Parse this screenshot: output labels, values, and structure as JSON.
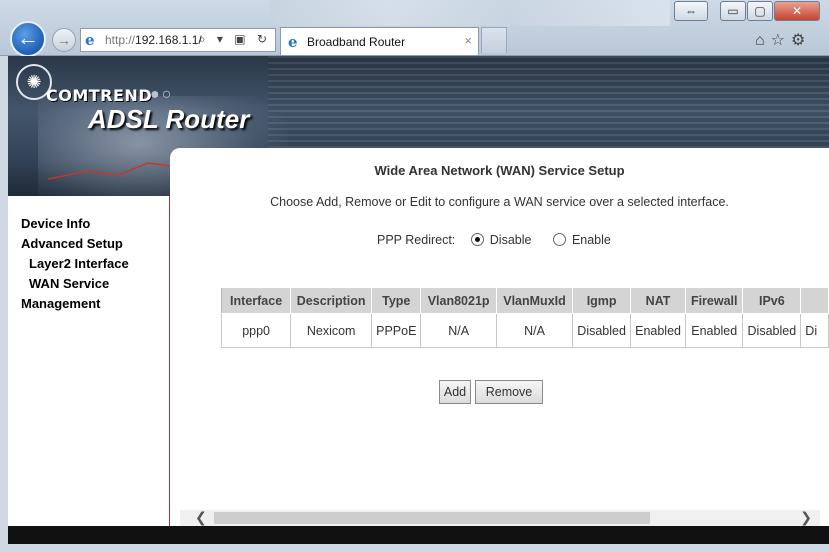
{
  "browser": {
    "url_host": "http://",
    "url_path": "192.168.1.1/",
    "address_tools": "⌕ ▾ ▣ ↻",
    "tab_title": "Broadband Router",
    "tab_close": "×",
    "back_glyph": "←",
    "forward_glyph": "→",
    "right_icons": "⌂☆⚙",
    "window_buttons": {
      "restore": "⇔",
      "minimize": "▭",
      "maximize": "▢",
      "close": "✕"
    }
  },
  "banner": {
    "brand": "COMTREND",
    "dots": "●○",
    "product": "ADSL Router"
  },
  "sidebar": {
    "items": [
      {
        "label": "Device Info",
        "sub": false
      },
      {
        "label": "Advanced Setup",
        "sub": false
      },
      {
        "label": "Layer2 Interface",
        "sub": true
      },
      {
        "label": "WAN Service",
        "sub": true
      },
      {
        "label": "Management",
        "sub": false
      }
    ]
  },
  "main": {
    "heading": "Wide Area Network (WAN) Service Setup",
    "hint": "Choose Add, Remove or Edit to configure a WAN service over a selected interface.",
    "ppp_redirect": {
      "label": "PPP Redirect:",
      "options": [
        "Disable",
        "Enable"
      ],
      "selected": "Disable"
    },
    "table": {
      "headers": [
        "Interface",
        "Description",
        "Type",
        "Vlan8021p",
        "VlanMuxId",
        "Igmp",
        "NAT",
        "Firewall",
        "IPv6",
        ""
      ],
      "rows": [
        [
          "ppp0",
          "Nexicom",
          "PPPoE",
          "N/A",
          "N/A",
          "Disabled",
          "Enabled",
          "Enabled",
          "Disabled",
          "Di"
        ]
      ]
    },
    "buttons": {
      "add": "Add",
      "remove": "Remove"
    }
  },
  "scrollbar": {
    "left": "❮",
    "right": "❯"
  },
  "colors": {
    "accent": "#2d74c9",
    "sidebar_border": "#aa3333",
    "table_header": "#d4d4d4"
  }
}
